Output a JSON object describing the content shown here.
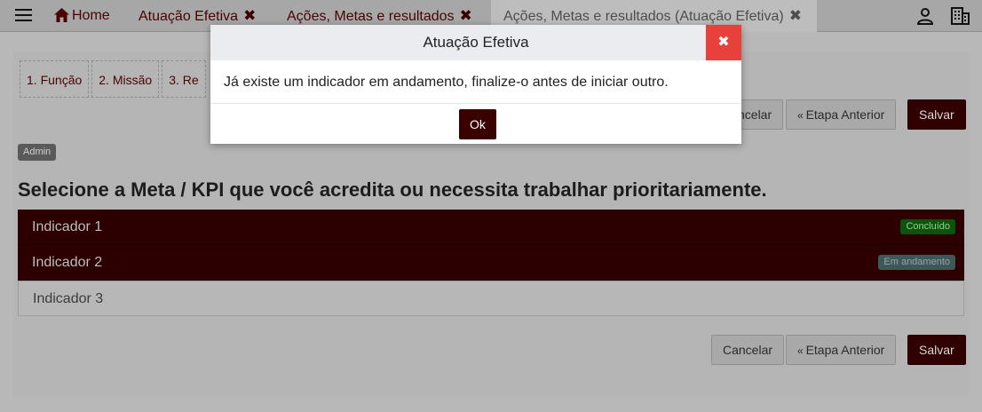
{
  "nav": {
    "home_label": "Home",
    "tabs": [
      {
        "label": "Atuação Efetiva",
        "close": "✖"
      },
      {
        "label": "Ações, Metas e resultados",
        "close": "✖"
      },
      {
        "label": "Ações, Metas e resultados (Atuação Efetiva)",
        "close": "✖"
      }
    ],
    "icons": [
      "menu-icon",
      "home-icon",
      "user-icon",
      "building-icon"
    ]
  },
  "steps": [
    "1. Função",
    "2. Missão",
    "3. Re"
  ],
  "toolbar": {
    "cancel_label": "Cancelar",
    "cancel_partial_label": "ncelar",
    "prev_label": "Etapa Anterior",
    "prev_icon": "«",
    "save_label": "Salvar"
  },
  "admin_badge": "Admin",
  "title": "Selecione a Meta / KPI que você acredita ou necessita trabalhar prioritariamente.",
  "indicators": [
    {
      "label": "Indicador 1",
      "status": "Concluído"
    },
    {
      "label": "Indicador 2",
      "status": "Em andamento"
    },
    {
      "label": "Indicador 3",
      "status": ""
    }
  ],
  "modal": {
    "title": "Atuação Efetiva",
    "close": "✖",
    "message": "Já existe um indicador em andamento, finalize-o antes de iniciar outro.",
    "ok_label": "Ok"
  },
  "colors": {
    "brand_dark_red": "#3a0000",
    "close_red": "#e8413c",
    "status_done": "#0c540c",
    "status_progress": "#3e5757"
  }
}
